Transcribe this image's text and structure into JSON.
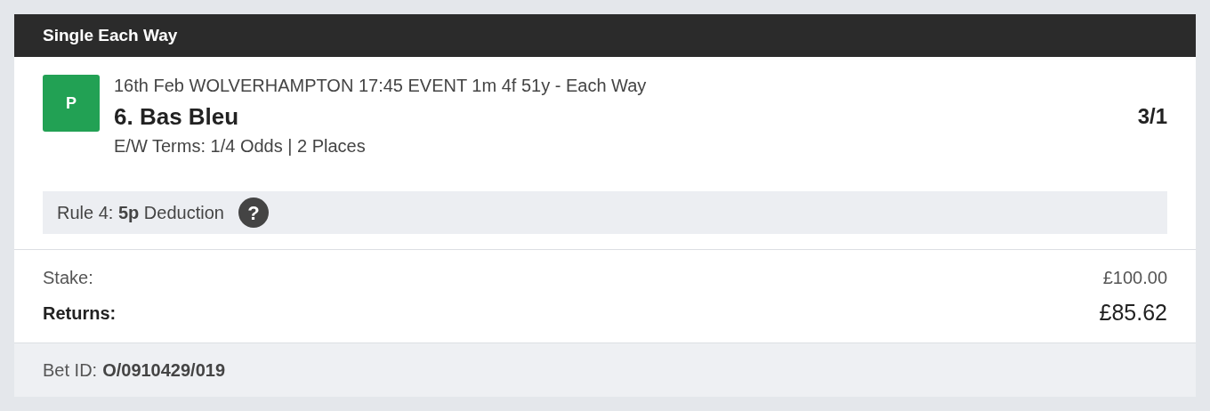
{
  "header": {
    "title": "Single Each Way"
  },
  "selection": {
    "badge": "P",
    "event": "16th Feb WOLVERHAMPTON 17:45 EVENT 1m 4f 51y - Each Way",
    "runner": "6. Bas Bleu",
    "odds": "3/1",
    "terms": "E/W Terms: 1/4 Odds | 2 Places"
  },
  "rule4": {
    "text": "Rule 4: **5p** Deduction",
    "help_icon": "?"
  },
  "totals": [
    {
      "label": "Stake:",
      "value": "£100.00",
      "kind": "normal"
    },
    {
      "label": "Returns:",
      "value": "£85.62",
      "kind": "emphasis"
    }
  ],
  "bet_id": {
    "label": "Bet ID:",
    "value": "O/0910429/019"
  }
}
